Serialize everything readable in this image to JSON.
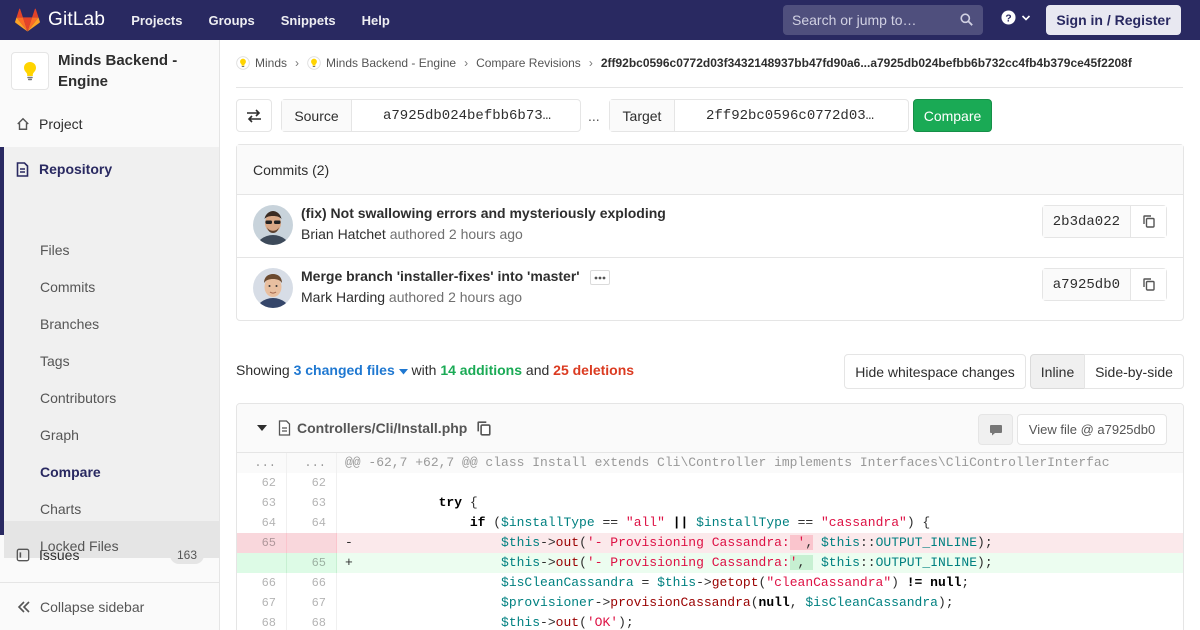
{
  "navbar": {
    "brand": "GitLab",
    "links": [
      "Projects",
      "Groups",
      "Snippets",
      "Help"
    ],
    "search_placeholder": "Search or jump to…",
    "signin_label": "Sign in / Register",
    "brand_color": "#292961"
  },
  "sidebar": {
    "project_name": "Minds Backend - Engine",
    "project": "Project",
    "repository": "Repository",
    "repo_items": [
      "Files",
      "Commits",
      "Branches",
      "Tags",
      "Contributors",
      "Graph",
      "Compare",
      "Charts",
      "Locked Files"
    ],
    "active_item": "Compare",
    "issues": "Issues",
    "issues_count": "163",
    "collapse": "Collapse sidebar"
  },
  "breadcrumb": {
    "items": [
      "Minds",
      "Minds Backend - Engine",
      "Compare Revisions"
    ],
    "current": "2ff92bc0596c0772d03f3432148937bb47fd90a6...a7925db024befbb6b732cc4fb4b379ce45f2208f"
  },
  "compare": {
    "source_label": "Source",
    "source_value": "a7925db024befbb6b73…",
    "separator": "...",
    "target_label": "Target",
    "target_value": "2ff92bc0596c0772d03…",
    "button": "Compare"
  },
  "commits": {
    "header": "Commits (2)",
    "authored_word": "authored",
    "items": [
      {
        "title": "(fix) Not swallowing errors and mysteriously exploding",
        "author": "Brian Hatchet",
        "time": "2 hours ago",
        "sha": "2b3da022"
      },
      {
        "title": "Merge branch 'installer-fixes' into 'master'",
        "author": "Mark Harding",
        "time": "2 hours ago",
        "sha": "a7925db0"
      }
    ]
  },
  "stats": {
    "showing": "Showing",
    "changed_files": "3 changed files",
    "with": "with",
    "additions": "14 additions",
    "and": "and",
    "deletions": "25 deletions"
  },
  "view_controls": {
    "whitespace": "Hide whitespace changes",
    "inline": "Inline",
    "side_by_side": "Side-by-side"
  },
  "file": {
    "path": "Controllers/Cli/Install.php",
    "view_file": "View file @ a7925db0",
    "hunk_header": "@@ -62,7 +62,7 @@ class Install extends Cli\\Controller implements Interfaces\\CliControllerInterfac",
    "ellipsis": "...",
    "lines": [
      {
        "old": "62",
        "new": "62"
      },
      {
        "old": "63",
        "new": "63"
      },
      {
        "old": "64",
        "new": "64"
      },
      {
        "old": "65",
        "new": "",
        "marker": "-"
      },
      {
        "old": "",
        "new": "65",
        "marker": "+"
      },
      {
        "old": "66",
        "new": "66"
      },
      {
        "old": "67",
        "new": "67"
      },
      {
        "old": "68",
        "new": "68"
      }
    ]
  }
}
